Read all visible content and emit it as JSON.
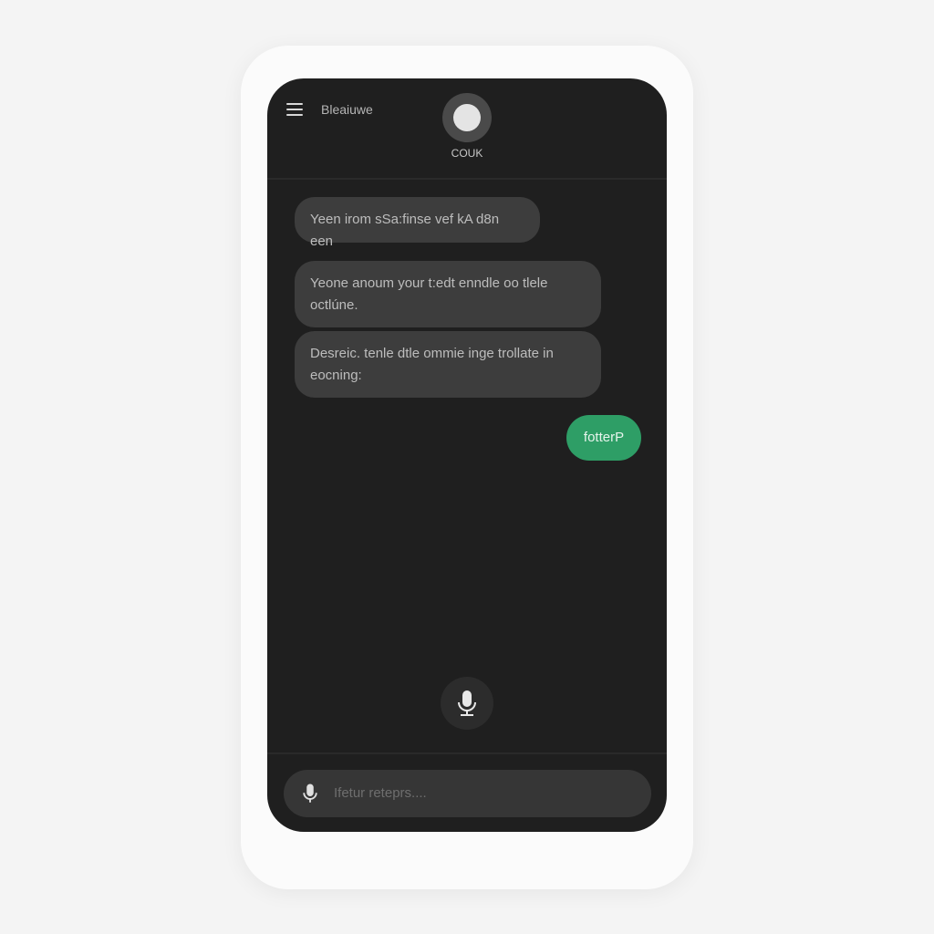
{
  "header": {
    "title": "Bleaiuwe",
    "contact_name": "COUK",
    "menu_icon": "hamburger-menu-icon",
    "avatar_icon": "avatar-circle"
  },
  "messages": [
    {
      "from": "other",
      "text": "Yeen irom sSa:finse vef kA d8n een"
    },
    {
      "from": "other",
      "text": "Yeone anoum your t:edt enndle oo tlele octlúne."
    },
    {
      "from": "other",
      "text": "Desreic. tenle dtle ommie inge trollate in eocning:"
    },
    {
      "from": "me",
      "text": "fotterP"
    }
  ],
  "voice_button": {
    "icon": "microphone-icon"
  },
  "composer": {
    "placeholder": "Ifetur reteprs....",
    "icon": "microphone-icon"
  },
  "colors": {
    "screen_bg": "#1f1f1f",
    "bubble_bg": "#3d3d3d",
    "accent_green": "#2e9e66"
  }
}
